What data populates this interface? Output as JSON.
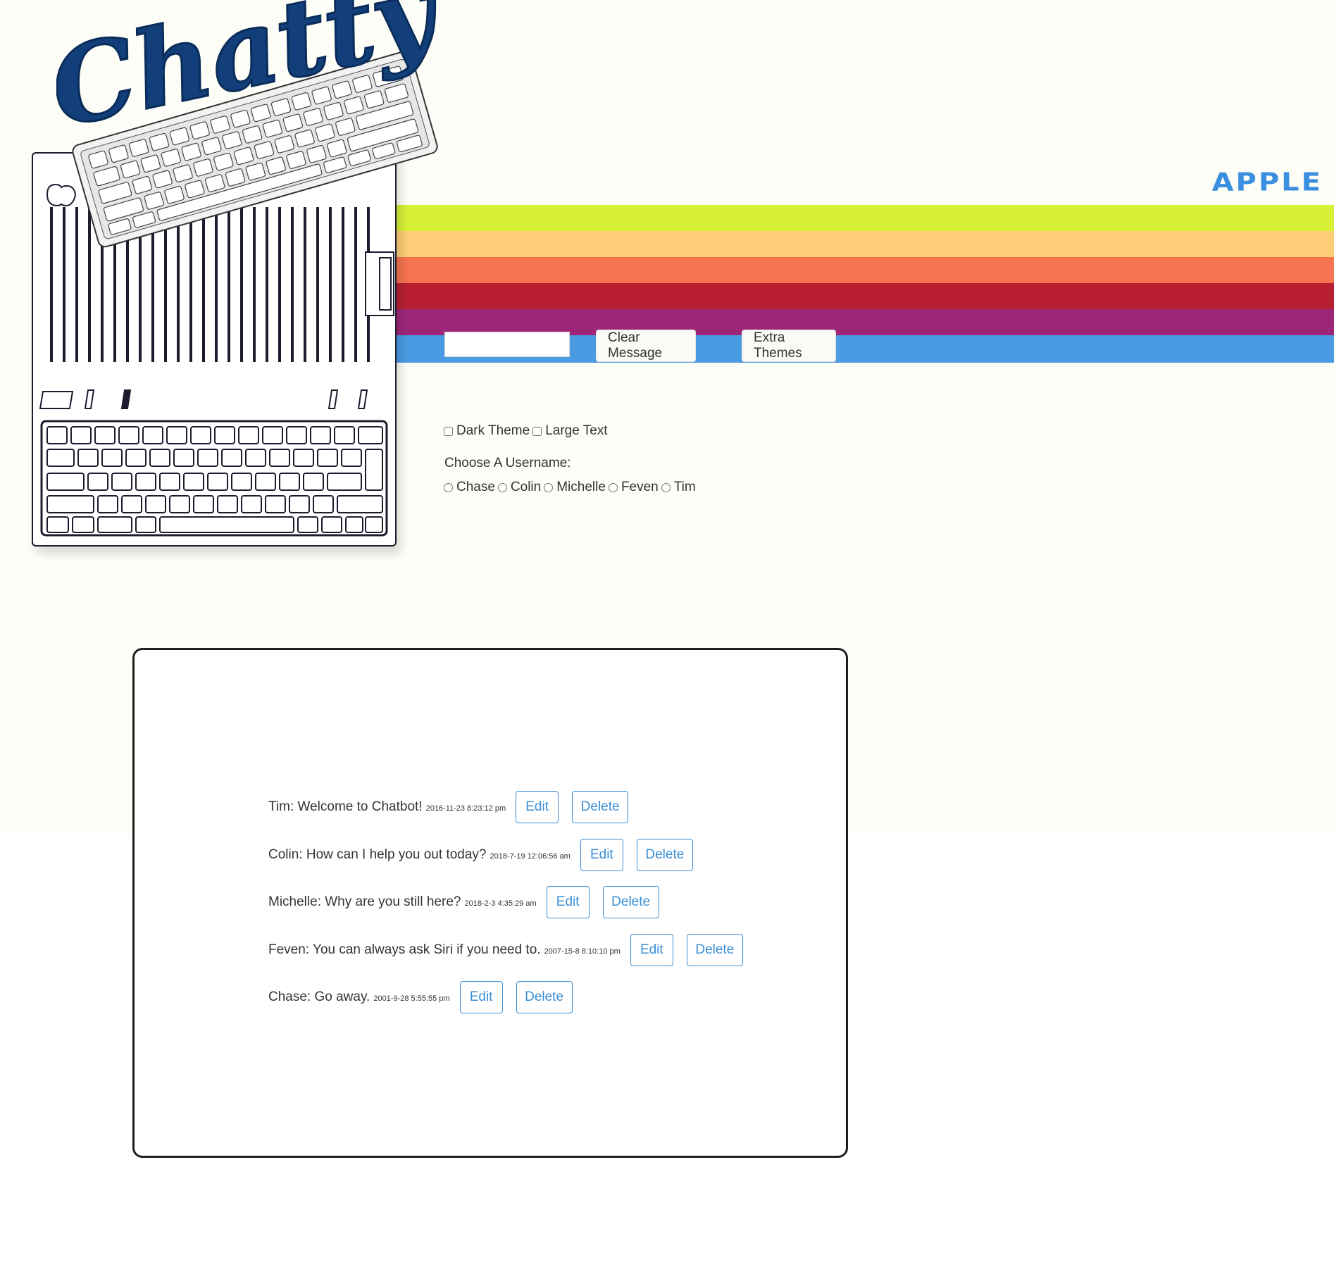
{
  "header": {
    "logo_text": "Chatty",
    "brand_text": "APPLE"
  },
  "colors": {
    "stripes": [
      "#d7ef35",
      "#fdcd78",
      "#f6744f",
      "#b91f33",
      "#9e2679",
      "#4a9be3"
    ],
    "accent": "#3a8ed6"
  },
  "controls": {
    "message_input_value": "",
    "clear_button": "Clear Message",
    "themes_button": "Extra Themes"
  },
  "options": {
    "dark_theme": "Dark Theme",
    "large_text": "Large Text",
    "choose_username": "Choose A Username:",
    "usernames": [
      "Chase",
      "Colin",
      "Michelle",
      "Feven",
      "Tim"
    ]
  },
  "messages": [
    {
      "text": "Tim: Welcome to Chatbot!",
      "time": "2016-11-23 8:23:12 pm"
    },
    {
      "text": "Colin: How can I help you out today?",
      "time": "2018-7-19 12:06:56 am"
    },
    {
      "text": "Michelle: Why are you still here?",
      "time": "2018-2-3 4:35:29 am"
    },
    {
      "text": "Feven: You can always ask Siri if you need to.",
      "time": "2007-15-8 8:10:10 pm"
    },
    {
      "text": "Chase: Go away.",
      "time": "2001-9-28 5:55:55 pm"
    }
  ],
  "message_buttons": {
    "edit": "Edit",
    "delete": "Delete"
  }
}
